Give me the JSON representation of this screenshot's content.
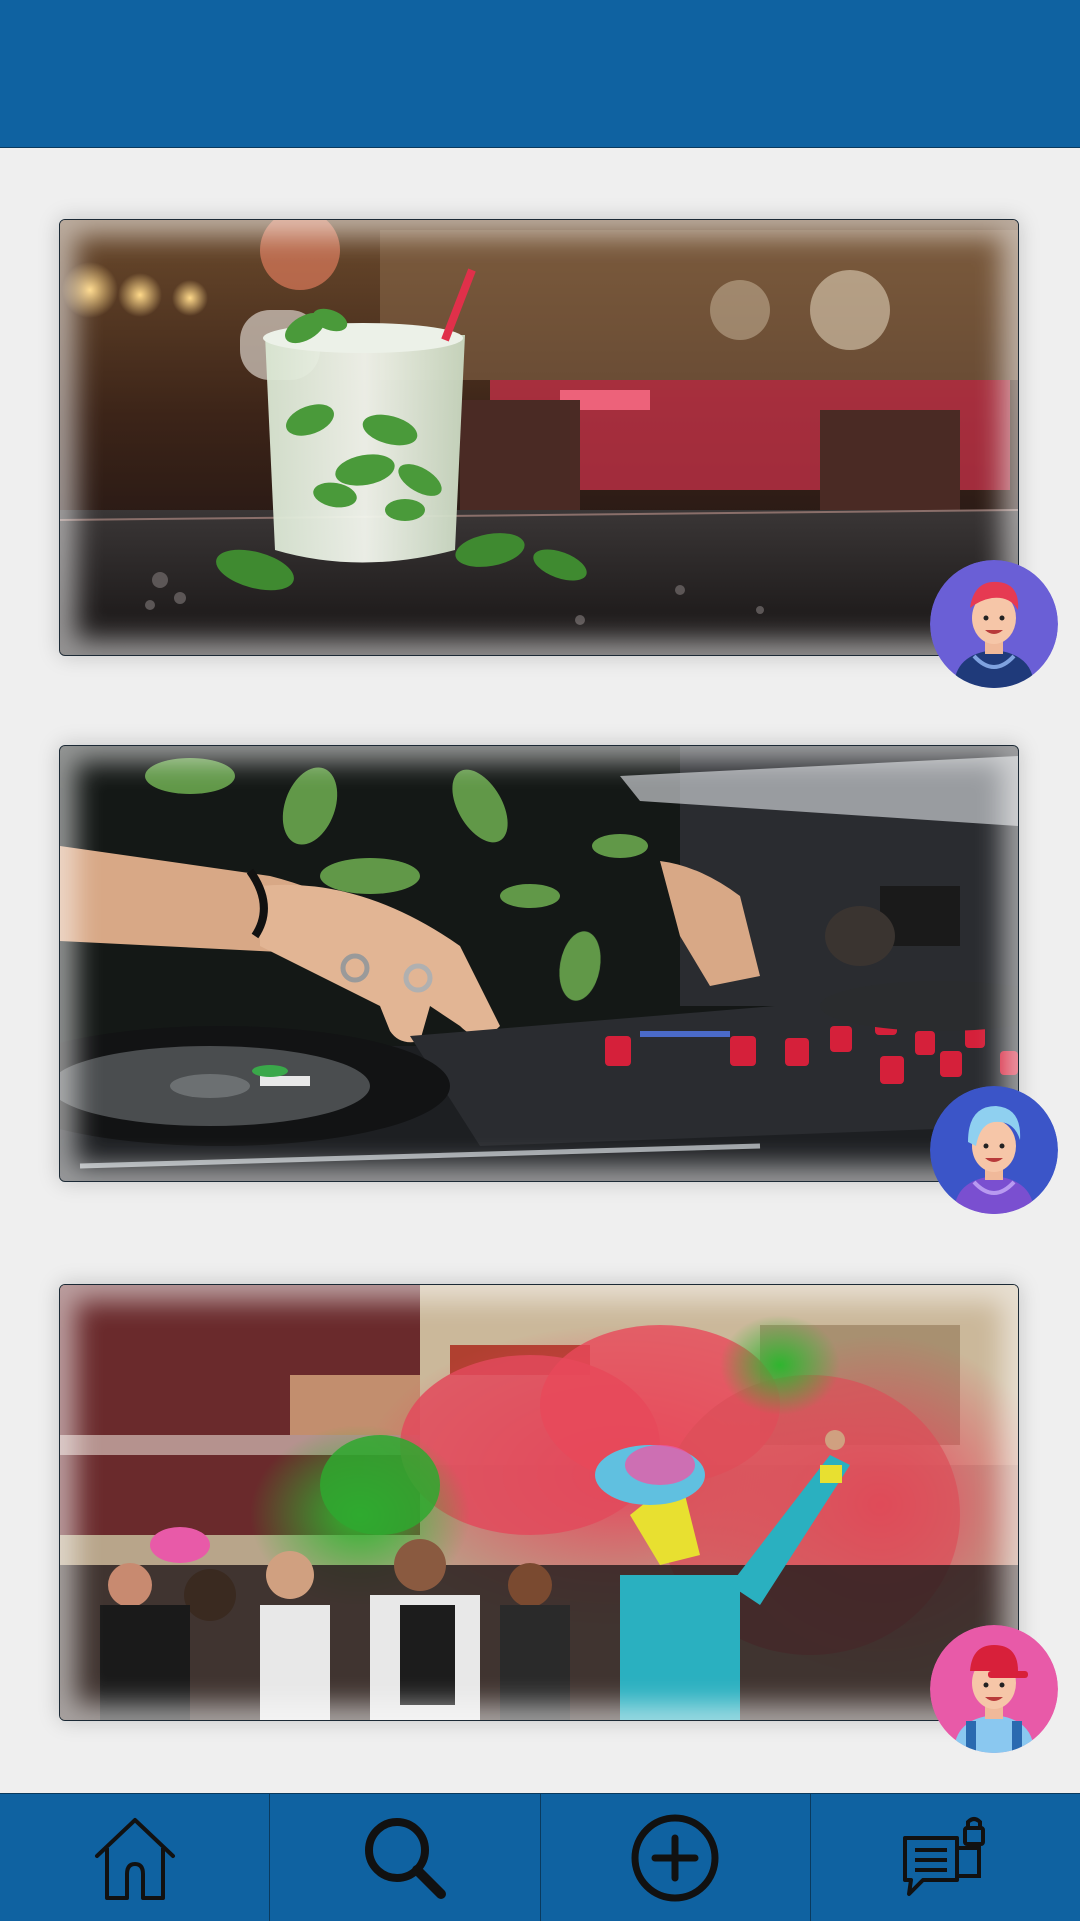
{
  "header": {
    "title": ""
  },
  "posts": [
    {
      "photo_icon": "mojito-bar-photo",
      "avatar_icon": "user-avatar-red-hair",
      "avatar_bg": "#6a5fd6"
    },
    {
      "photo_icon": "dj-turntable-photo",
      "avatar_icon": "user-avatar-blue-hair",
      "avatar_bg": "#3b55c8"
    },
    {
      "photo_icon": "color-smoke-festival-photo",
      "avatar_icon": "user-avatar-pink-bg",
      "avatar_bg": "#e85aa8"
    }
  ],
  "nav": [
    {
      "icon": "home-icon"
    },
    {
      "icon": "search-icon"
    },
    {
      "icon": "add-circle-icon"
    },
    {
      "icon": "messages-icon"
    }
  ],
  "colors": {
    "bar": "#0f62a1",
    "background": "#efefef",
    "icon": "#111111"
  }
}
